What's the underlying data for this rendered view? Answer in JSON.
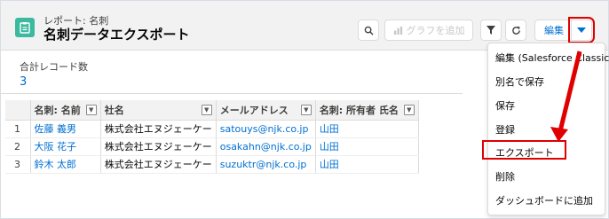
{
  "header": {
    "subtitle": "レポート: 名刺",
    "title": "名刺データエクスポート",
    "add_graph_label": "グラフを追加",
    "edit_label": "編集"
  },
  "summary": {
    "record_count_label": "合計レコード数",
    "record_count_value": "3"
  },
  "table": {
    "columns": [
      "名刺: 名前",
      "社名",
      "メールアドレス",
      "名刺: 所有者 氏名"
    ],
    "rows": [
      {
        "num": "1",
        "name": "佐藤 義男",
        "company": "株式会社エヌジェーケー",
        "email": "satouys@njk.co.jp",
        "owner": "山田"
      },
      {
        "num": "2",
        "name": "大阪 花子",
        "company": "株式会社エヌジェーケー",
        "email": "osakahn@njk.co.jp",
        "owner": "山田"
      },
      {
        "num": "3",
        "name": "鈴木 太郎",
        "company": "株式会社エヌジェーケー",
        "email": "suzuktr@njk.co.jp",
        "owner": "山田"
      }
    ]
  },
  "menu": {
    "items": [
      "編集 (Salesforce Classic)",
      "別名で保存",
      "保存",
      "登録",
      "エクスポート",
      "削除",
      "ダッシュボードに追加"
    ],
    "highlighted": "エクスポート"
  },
  "colors": {
    "accent": "#0070d2",
    "app_icon": "#3bba9f",
    "annotation_red": "#e00000"
  },
  "icons": [
    "report-icon",
    "search-icon",
    "chart-icon",
    "filter-icon",
    "refresh-icon",
    "chevron-down-icon"
  ]
}
